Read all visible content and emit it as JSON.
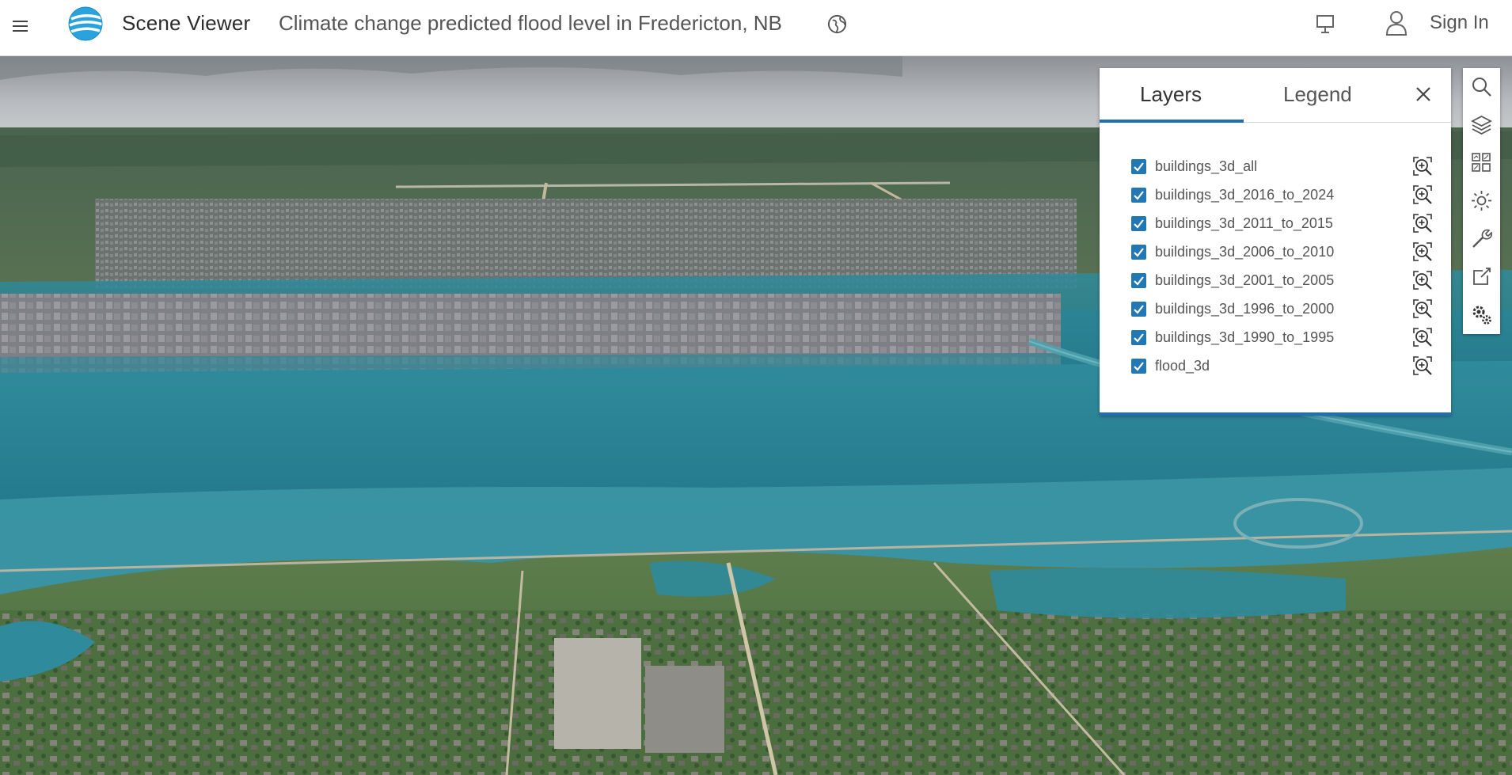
{
  "header": {
    "menu_icon": "hamburger-menu-icon",
    "logo_icon": "arcgis-globe-logo",
    "app_name": "Scene Viewer",
    "scene_title": "Climate change predicted flood level in Fredericton, NB",
    "globe_icon": "globe-info-icon",
    "present_icon": "presentation-icon",
    "user_icon": "user-icon",
    "sign_in_label": "Sign In"
  },
  "panel": {
    "tabs": [
      {
        "label": "Layers",
        "active": true
      },
      {
        "label": "Legend",
        "active": false
      }
    ],
    "close_icon": "close-icon",
    "layers": [
      {
        "name": "buildings_3d_all",
        "visible": true
      },
      {
        "name": "buildings_3d_2016_to_2024",
        "visible": true
      },
      {
        "name": "buildings_3d_2011_to_2015",
        "visible": true
      },
      {
        "name": "buildings_3d_2006_to_2010",
        "visible": true
      },
      {
        "name": "buildings_3d_2001_to_2005",
        "visible": true
      },
      {
        "name": "buildings_3d_1996_to_2000",
        "visible": true
      },
      {
        "name": "buildings_3d_1990_to_1995",
        "visible": true
      },
      {
        "name": "flood_3d",
        "visible": true
      }
    ],
    "zoom_icon": "zoom-to-layer-icon"
  },
  "tools": [
    {
      "icon": "search-icon"
    },
    {
      "icon": "layers-icon"
    },
    {
      "icon": "basemap-gallery-icon"
    },
    {
      "icon": "daylight-icon"
    },
    {
      "icon": "measure-tools-icon"
    },
    {
      "icon": "share-icon"
    },
    {
      "icon": "settings-icon"
    }
  ],
  "colors": {
    "accent": "#1f6fb5",
    "checkbox": "#2277b5",
    "flood_water": "#2f8a99",
    "buildings": "#8a8a8f",
    "vegetation": "#3f6a3a",
    "sky": "#9a9ea3"
  }
}
